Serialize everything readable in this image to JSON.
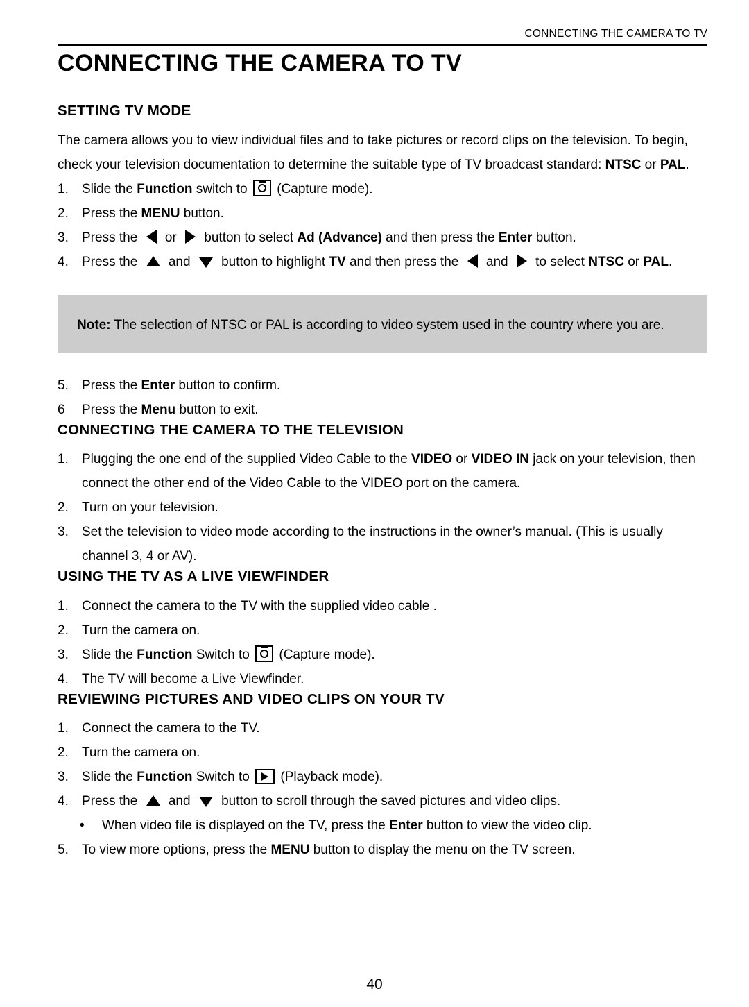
{
  "running_header": "CONNECTING THE CAMERA TO TV",
  "page_title": "CONNECTING THE CAMERA TO TV",
  "page_number": "40",
  "colors": {
    "note_background": "#cccccc",
    "text": "#000000",
    "page_background": "#ffffff"
  },
  "sections": {
    "setting_tv_mode": {
      "heading": "SETTING TV MODE",
      "intro": {
        "part1": "The camera allows you to view individual files and to take pictures or record clips on the television. To begin, check your television documentation to determine the suitable type of TV broadcast standard: ",
        "bold1": "NTSC",
        "mid1": " or ",
        "bold2": "PAL",
        "tail": "."
      },
      "steps": {
        "s1": {
          "marker": "1.",
          "a": "Slide the ",
          "b": "Function",
          "c": " switch to ",
          "icon": "capture-mode-icon",
          "d": " (Capture mode)."
        },
        "s2": {
          "marker": "2.",
          "a": "Press the ",
          "b": "MENU",
          "c": " button."
        },
        "s3": {
          "marker": "3.",
          "a": "Press the ",
          "icon_left": "arrow-left-icon",
          "b": " or ",
          "icon_right": "arrow-right-icon",
          "c": " button to select ",
          "d": "Ad (Advance)",
          "e": " and then press the ",
          "f": "Enter",
          "g": " button."
        },
        "s4": {
          "marker": "4.",
          "a": "Press the ",
          "icon_up": "arrow-up-icon",
          "b": " and ",
          "icon_down": "arrow-down-icon",
          "c": " button to highlight ",
          "d": "TV",
          "e": " and then press the ",
          "icon_left": "arrow-left-icon",
          "f": " and ",
          "icon_right": "arrow-right-icon",
          "g": " to select ",
          "h": "NTSC",
          "i": " or ",
          "j": "PAL",
          "k": "."
        },
        "s5": {
          "marker": "5.",
          "a": "Press the ",
          "b": "Enter",
          "c": " button to confirm."
        },
        "s6": {
          "marker": "6",
          "a": "Press the ",
          "b": "Menu",
          "c": " button to exit."
        }
      },
      "note": {
        "label": "Note:",
        "text": " The selection of NTSC or PAL is according to video system used in the country where you are."
      }
    },
    "connecting_to_television": {
      "heading": "CONNECTING THE CAMERA TO THE TELEVISION",
      "steps": {
        "s1": {
          "marker": "1.",
          "a": "Plugging the one end of the supplied Video Cable to the ",
          "b": "VIDEO",
          "c": " or ",
          "d": "VIDEO IN",
          "e": " jack on your television, then connect the other end of the Video Cable to the VIDEO port on the camera."
        },
        "s2": {
          "marker": "2.",
          "a": "Turn on your television."
        },
        "s3": {
          "marker": "3.",
          "a": "Set the television to video mode according to the instructions in the owner’s manual. (This is usually channel 3, 4 or AV)."
        }
      }
    },
    "live_viewfinder": {
      "heading": "USING THE TV AS A LIVE VIEWFINDER",
      "steps": {
        "s1": {
          "marker": "1.",
          "a": "Connect the camera to the TV with the supplied video cable ."
        },
        "s2": {
          "marker": "2.",
          "a": "Turn the camera on."
        },
        "s3": {
          "marker": "3.",
          "a": "Slide the ",
          "b": "Function",
          "c": " Switch to ",
          "icon": "capture-mode-icon",
          "d": " (Capture mode)."
        },
        "s4": {
          "marker": "4.",
          "a": "The TV will become a Live Viewfinder."
        }
      }
    },
    "reviewing": {
      "heading": "REVIEWING PICTURES AND VIDEO CLIPS ON YOUR TV",
      "steps": {
        "s1": {
          "marker": "1.",
          "a": "Connect the camera to the TV."
        },
        "s2": {
          "marker": "2.",
          "a": "Turn the camera on."
        },
        "s3": {
          "marker": "3.",
          "a": "Slide the ",
          "b": "Function",
          "c": " Switch to ",
          "icon": "playback-mode-icon",
          "d": " (Playback mode)."
        },
        "s4": {
          "marker": "4.",
          "a": "Press the ",
          "icon_up": "arrow-up-icon",
          "b": " and ",
          "icon_down": "arrow-down-icon",
          "c": " button to scroll through the saved pictures and video clips."
        },
        "sub": {
          "marker": "•",
          "a": "When video file is displayed on the TV, press the ",
          "b": "Enter",
          "c": " button to view the video clip."
        },
        "s5": {
          "marker": "5.",
          "a": "To view more options, press the ",
          "b": "MENU",
          "c": " button to display the menu on the TV screen."
        }
      }
    }
  }
}
